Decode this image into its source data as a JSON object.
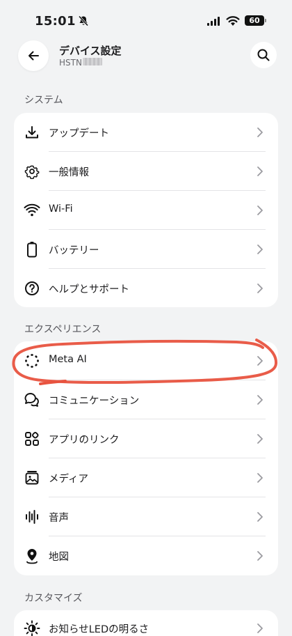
{
  "status_bar": {
    "time": "15:01",
    "battery": "60"
  },
  "header": {
    "title": "デバイス設定",
    "subtitle": "HSTN"
  },
  "sections": [
    {
      "label": "システム",
      "items": [
        {
          "label": "アップデート",
          "icon": "download-icon"
        },
        {
          "label": "一般情報",
          "icon": "gear-icon"
        },
        {
          "label": "Wi-Fi",
          "icon": "wifi-icon"
        },
        {
          "label": "バッテリー",
          "icon": "battery-icon"
        },
        {
          "label": "ヘルプとサポート",
          "icon": "help-icon"
        }
      ]
    },
    {
      "label": "エクスペリエンス",
      "items": [
        {
          "label": "Meta AI",
          "icon": "meta-ai-icon"
        },
        {
          "label": "コミュニケーション",
          "icon": "chat-bubbles-icon"
        },
        {
          "label": "アプリのリンク",
          "icon": "apps-grid-icon"
        },
        {
          "label": "メディア",
          "icon": "media-icon"
        },
        {
          "label": "音声",
          "icon": "audio-waveform-icon"
        },
        {
          "label": "地図",
          "icon": "map-pin-icon"
        }
      ]
    },
    {
      "label": "カスタマイズ",
      "items": [
        {
          "label": "お知らせLEDの明るさ",
          "icon": "brightness-icon"
        }
      ]
    }
  ],
  "colors": {
    "background": "#f2f3f4",
    "card": "#ffffff",
    "annotation": "#e8533f"
  }
}
